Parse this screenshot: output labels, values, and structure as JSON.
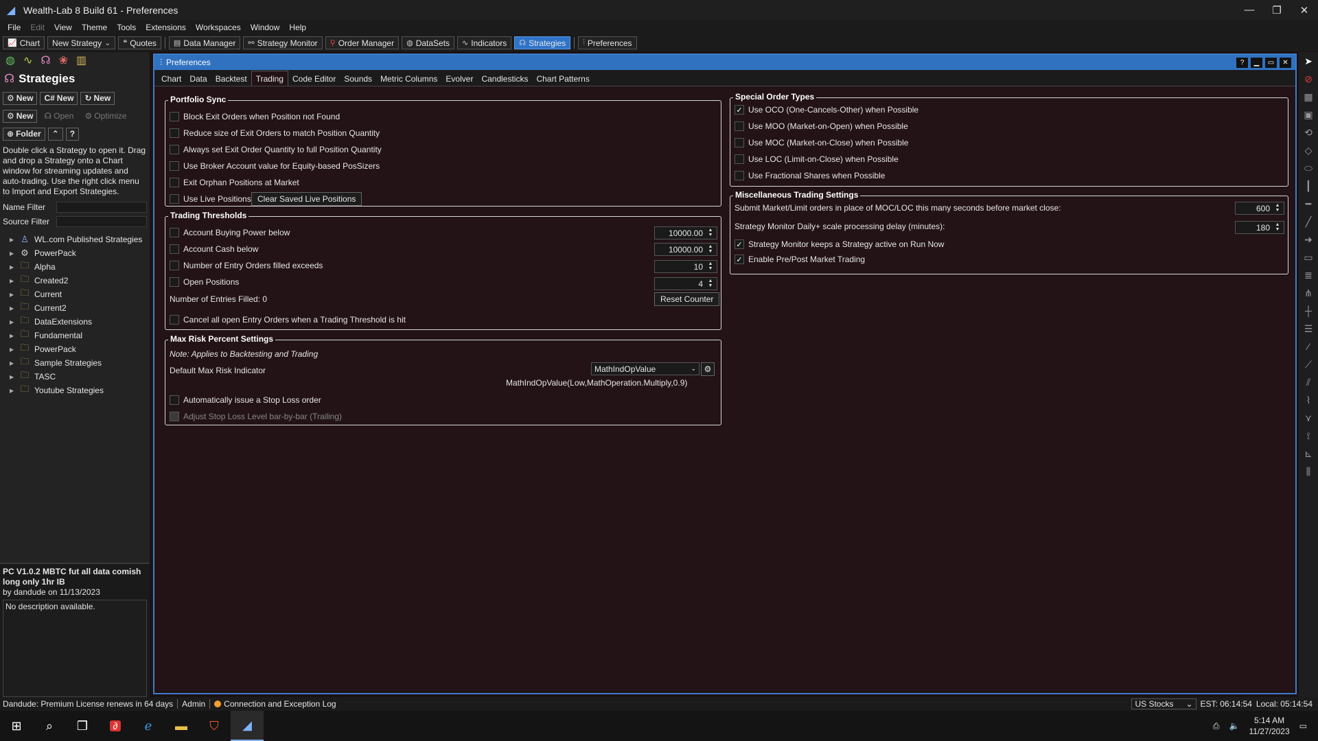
{
  "window": {
    "title": "Wealth-Lab 8 Build 61 - Preferences",
    "controls": [
      "—",
      "❐",
      "✕"
    ]
  },
  "menu": [
    {
      "label": "File",
      "enabled": true
    },
    {
      "label": "Edit",
      "enabled": false
    },
    {
      "label": "View",
      "enabled": true
    },
    {
      "label": "Theme",
      "enabled": true
    },
    {
      "label": "Tools",
      "enabled": true
    },
    {
      "label": "Extensions",
      "enabled": true
    },
    {
      "label": "Workspaces",
      "enabled": true
    },
    {
      "label": "Window",
      "enabled": true
    },
    {
      "label": "Help",
      "enabled": true
    }
  ],
  "toolbar": {
    "chart": "Chart",
    "new_strategy": "New Strategy",
    "quotes": "Quotes",
    "data_manager": "Data Manager",
    "strategy_monitor": "Strategy Monitor",
    "order_manager": "Order Manager",
    "datasets": "DataSets",
    "indicators": "Indicators",
    "strategies": "Strategies",
    "preferences": "Preferences"
  },
  "left": {
    "header": "Strategies",
    "row1": [
      "New",
      "New",
      "New"
    ],
    "row2": {
      "new": "New",
      "open": "Open",
      "optimize": "Optimize"
    },
    "row3": {
      "folder": "Folder",
      "collapse": "⌃",
      "help": "?"
    },
    "help_text": "Double click a Strategy to open it. Drag and drop a Strategy onto a Chart window for streaming updates and auto-trading. Use the right click menu to Import and Export Strategies.",
    "name_filter": "Name Filter",
    "source_filter": "Source Filter",
    "tree": [
      {
        "label": "WL.com Published Strategies",
        "icon": "person-icon"
      },
      {
        "label": "PowerPack",
        "icon": "gear-icon"
      },
      {
        "label": "Alpha",
        "icon": "folder-icon"
      },
      {
        "label": "Created2",
        "icon": "folder-icon"
      },
      {
        "label": "Current",
        "icon": "folder-icon"
      },
      {
        "label": "Current2",
        "icon": "folder-icon"
      },
      {
        "label": "DataExtensions",
        "icon": "folder-icon"
      },
      {
        "label": "Fundamental",
        "icon": "folder-icon"
      },
      {
        "label": "PowerPack",
        "icon": "folder-icon"
      },
      {
        "label": "Sample Strategies",
        "icon": "folder-icon"
      },
      {
        "label": "TASC",
        "icon": "folder-icon"
      },
      {
        "label": "Youtube Strategies",
        "icon": "folder-icon"
      }
    ],
    "selected_strategy": {
      "title": "PC V1.0.2 MBTC fut all data comish long only 1hr IB",
      "author": "by dandude on 11/13/2023",
      "description": "No description available."
    }
  },
  "prefs": {
    "title": "Preferences",
    "tabs": [
      "Chart",
      "Data",
      "Backtest",
      "Trading",
      "Code Editor",
      "Sounds",
      "Metric Columns",
      "Evolver",
      "Candlesticks",
      "Chart Patterns"
    ],
    "active_tab": "Trading",
    "portfolio_sync": {
      "legend": "Portfolio Sync",
      "items": [
        {
          "label": "Block Exit Orders when Position not Found",
          "checked": false
        },
        {
          "label": "Reduce size of Exit Orders to match Position Quantity",
          "checked": false
        },
        {
          "label": "Always set Exit Order Quantity to full Position Quantity",
          "checked": false
        },
        {
          "label": "Use Broker Account value for Equity-based PosSizers",
          "checked": false
        },
        {
          "label": "Exit Orphan Positions at Market",
          "checked": false
        },
        {
          "label": "Use Live Positions",
          "checked": false
        }
      ],
      "clear_button": "Clear Saved Live Positions"
    },
    "thresholds": {
      "legend": "Trading Thresholds",
      "items": [
        {
          "label": "Account Buying Power below",
          "checked": false,
          "value": "10000.00"
        },
        {
          "label": "Account Cash below",
          "checked": false,
          "value": "10000.00"
        },
        {
          "label": "Number of Entry Orders filled exceeds",
          "checked": false,
          "value": "10"
        },
        {
          "label": "Open Positions",
          "checked": false,
          "value": "4"
        }
      ],
      "entries_filled": "Number of Entries Filled: 0",
      "reset_button": "Reset Counter",
      "cancel_all": "Cancel all open Entry Orders when a Trading Threshold is hit"
    },
    "max_risk": {
      "legend": "Max Risk Percent Settings",
      "note": "Note: Applies to Backtesting and Trading",
      "default_label": "Default Max Risk Indicator",
      "indicator": "MathIndOpValue",
      "expression": "MathIndOpValue(Low,MathOperation.Multiply,0.9)",
      "auto_stop": "Automatically issue a Stop Loss order",
      "adjust_stop": "Adjust Stop Loss Level bar-by-bar (Trailing)"
    },
    "special_orders": {
      "legend": "Special Order Types",
      "items": [
        {
          "label": "Use OCO (One-Cancels-Other) when Possible",
          "checked": true
        },
        {
          "label": "Use MOO (Market-on-Open) when Possible",
          "checked": false
        },
        {
          "label": "Use MOC (Market-on-Close) when Possible",
          "checked": false
        },
        {
          "label": "Use LOC (Limit-on-Close) when Possible",
          "checked": false
        },
        {
          "label": "Use Fractional Shares when Possible",
          "checked": false
        }
      ]
    },
    "misc": {
      "legend": "Miscellaneous Trading Settings",
      "submit_label": "Submit Market/Limit orders in place of MOC/LOC this many seconds before market close:",
      "submit_value": "600",
      "delay_label": "Strategy Monitor Daily+ scale processing delay (minutes):",
      "delay_value": "180",
      "keep_active": "Strategy Monitor keeps a Strategy active on Run Now",
      "keep_active_checked": true,
      "prepost": "Enable Pre/Post Market Trading",
      "prepost_checked": true
    }
  },
  "status": {
    "license": "Dandude: Premium License renews in 64 days",
    "admin": "Admin",
    "log": "Connection and Exception Log",
    "market": "US Stocks",
    "est": "EST: 06:14:54",
    "local": "Local: 05:14:54"
  },
  "taskbar": {
    "time": "5:14 AM",
    "date": "11/27/2023"
  },
  "colors": {
    "accent": "#3072c0",
    "background": "#231316",
    "status_dot": "#f0a030"
  }
}
